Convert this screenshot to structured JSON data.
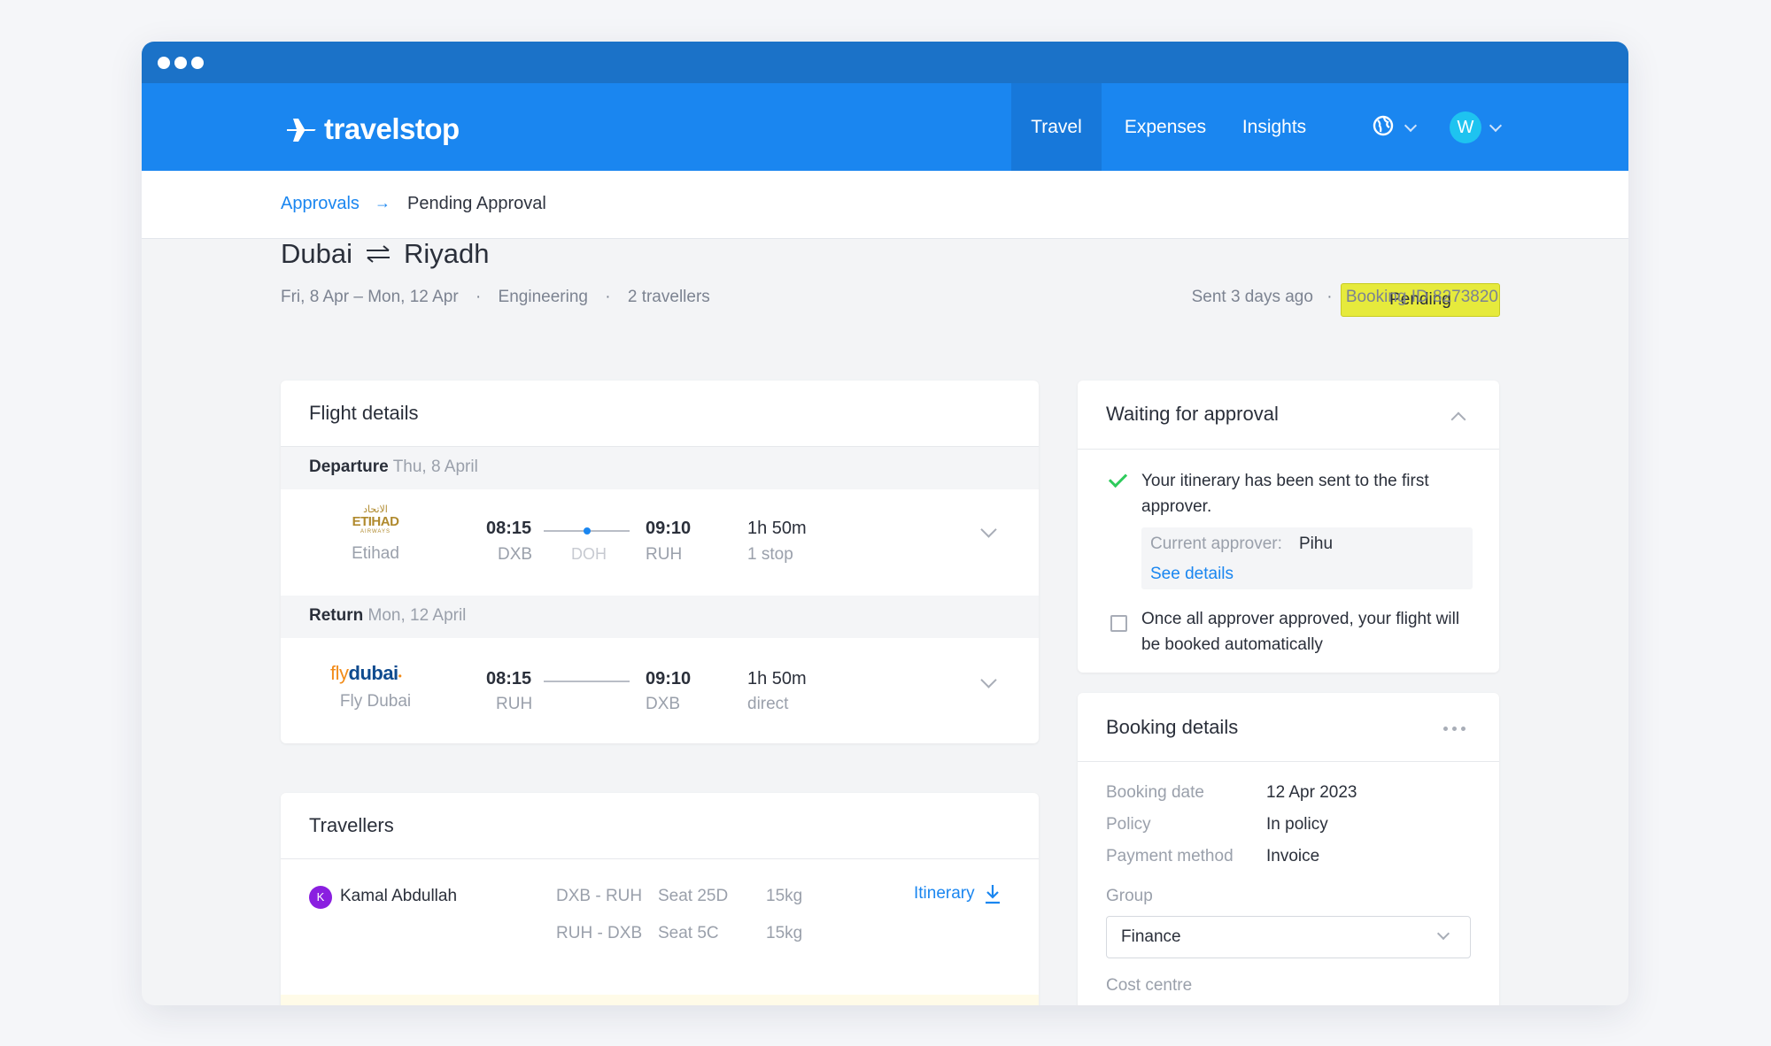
{
  "app": {
    "brand": "travelstop",
    "nav": [
      "Travel",
      "Expenses",
      "Insights"
    ],
    "active_nav": "Travel",
    "user_initial": "W"
  },
  "breadcrumb": {
    "parent": "Approvals",
    "current": "Pending Approval"
  },
  "trip": {
    "origin": "Dubai",
    "destination": "Riyadh",
    "dates": "Fri, 8 Apr – Mon, 12 Apr",
    "department": "Engineering",
    "travellers": "2 travellers",
    "status": "Pending",
    "sent": "Sent 3 days ago",
    "booking_id": "Booking ID 8273820"
  },
  "flight_details": {
    "title": "Flight details",
    "departure": {
      "label": "Departure",
      "date": "Thu, 8 April",
      "airline": "Etihad",
      "logo_text": "ETIHAD",
      "logo_sub": "AIRWAYS",
      "logo_arabic": "الاتحاد",
      "dep_time": "08:15",
      "dep_code": "DXB",
      "stop_code": "DOH",
      "arr_time": "09:10",
      "arr_code": "RUH",
      "duration": "1h 50m",
      "stops": "1 stop"
    },
    "return": {
      "label": "Return",
      "date": "Mon, 12 April",
      "airline": "Fly Dubai",
      "logo_fly": "fly",
      "logo_dubai": "dubai",
      "dep_time": "08:15",
      "dep_code": "RUH",
      "arr_time": "09:10",
      "arr_code": "DXB",
      "duration": "1h 50m",
      "stops": "direct"
    }
  },
  "travellers": {
    "title": "Travellers",
    "items": [
      {
        "initial": "K",
        "name": "Kamal Abdullah",
        "legs": [
          {
            "route": "DXB - RUH",
            "seat": "Seat 25D",
            "bag": "15kg"
          },
          {
            "route": "RUH - DXB",
            "seat": "Seat 5C",
            "bag": "15kg"
          }
        ],
        "itinerary_label": "Itinerary"
      }
    ]
  },
  "approval": {
    "title": "Waiting for approval",
    "step1": "Your itinerary has been sent to the first approver.",
    "current_approver_label": "Current approver:",
    "current_approver": "Pihu",
    "see_details": "See details",
    "step2": "Once all approver approved, your flight will be booked automatically"
  },
  "booking": {
    "title": "Booking details",
    "rows": [
      {
        "label": "Booking date",
        "value": "12 Apr 2023"
      },
      {
        "label": "Policy",
        "value": "In policy"
      },
      {
        "label": "Payment method",
        "value": "Invoice"
      }
    ],
    "group_label": "Group",
    "group_value": "Finance",
    "cost_centre_label": "Cost centre"
  },
  "colors": {
    "brand_blue": "#1a86f0",
    "pending_badge": "#e6ea3c",
    "success_green": "#2ecb5c",
    "traveller_avatar": "#8a1fe0"
  }
}
